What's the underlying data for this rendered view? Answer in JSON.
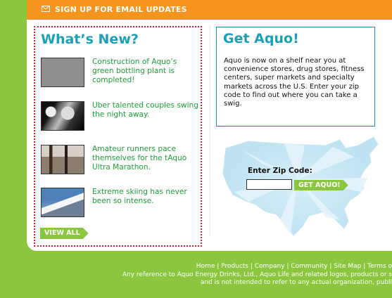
{
  "email_bar": {
    "label": "SIGN UP FOR EMAIL UPDATES"
  },
  "whats_new": {
    "title": "What’s New?",
    "items": [
      {
        "text": "Construction of Aquo’s green bottling plant is completed!",
        "thumb_icon": "placeholder-image"
      },
      {
        "text": "Uber talented couples swing the night away.",
        "thumb_icon": "dancers-photo"
      },
      {
        "text": "Amateur runners pace themselves for the tAquo Ultra Marathon.",
        "thumb_icon": "runners-photo"
      },
      {
        "text": "Extreme skiing has never been so intense.",
        "thumb_icon": "mountain-photo"
      }
    ],
    "view_all": "VIEW ALL"
  },
  "get_aquo": {
    "title": "Get Aquo!",
    "body": "Aquo is now on a shelf near you at convenience stores, drug stores, fitness centers, super markets and specialty markets across the U.S. Enter your zip code to find out where you can take a swig.",
    "zip_label": "Enter Zip Code:",
    "zip_value": "",
    "button": "GET AQUO!"
  },
  "footer": {
    "links": [
      "Home",
      "Products",
      "Company",
      "Community",
      "Site Map",
      "Terms o"
    ],
    "line2": "Any reference to Aquo Energy Drinks, Ltd., Aquo Life and related logos, products or s",
    "line3": "and is not intended to refer to any actual organization, publi"
  },
  "colors": {
    "green": "#8cc63f",
    "orange": "#f7941d",
    "teal": "#1aa0b9",
    "text_green": "#1e9e3c",
    "dotted_red": "#e0202a"
  }
}
